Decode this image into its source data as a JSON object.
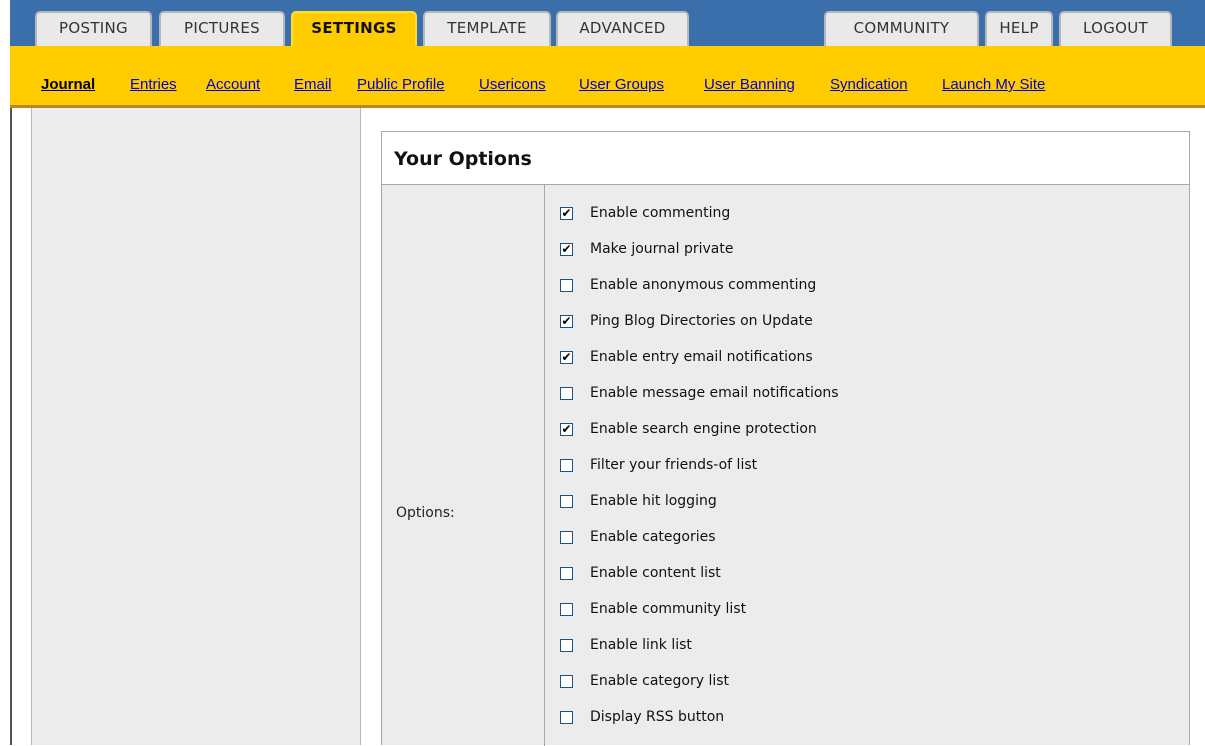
{
  "top_tabs": [
    {
      "label": "POSTING",
      "active": false
    },
    {
      "label": "PICTURES",
      "active": false
    },
    {
      "label": "SETTINGS",
      "active": true
    },
    {
      "label": "TEMPLATE",
      "active": false
    },
    {
      "label": "ADVANCED",
      "active": false
    },
    {
      "label": "COMMUNITY",
      "active": false
    },
    {
      "label": "HELP",
      "active": false
    },
    {
      "label": "LOGOUT",
      "active": false
    }
  ],
  "sub_nav": [
    {
      "label": "Journal",
      "active": true
    },
    {
      "label": "Entries",
      "active": false
    },
    {
      "label": "Account",
      "active": false
    },
    {
      "label": "Email",
      "active": false
    },
    {
      "label": "Public Profile",
      "active": false
    },
    {
      "label": "Usericons",
      "active": false
    },
    {
      "label": "User Groups",
      "active": false
    },
    {
      "label": "User Banning",
      "active": false
    },
    {
      "label": "Syndication",
      "active": false
    },
    {
      "label": "Launch My Site",
      "active": false
    }
  ],
  "options_panel": {
    "title": "Your Options",
    "label": "Options:",
    "items": [
      {
        "label": "Enable commenting",
        "checked": true
      },
      {
        "label": "Make journal private",
        "checked": true
      },
      {
        "label": "Enable anonymous commenting",
        "checked": false
      },
      {
        "label": "Ping Blog Directories on Update",
        "checked": true
      },
      {
        "label": "Enable entry email notifications",
        "checked": true
      },
      {
        "label": "Enable message email notifications",
        "checked": false
      },
      {
        "label": "Enable search engine protection",
        "checked": true
      },
      {
        "label": "Filter your friends-of list",
        "checked": false
      },
      {
        "label": "Enable hit logging",
        "checked": false
      },
      {
        "label": "Enable categories",
        "checked": false
      },
      {
        "label": "Enable content list",
        "checked": false
      },
      {
        "label": "Enable community list",
        "checked": false
      },
      {
        "label": "Enable link list",
        "checked": false
      },
      {
        "label": "Enable category list",
        "checked": false
      },
      {
        "label": "Display RSS button",
        "checked": false
      }
    ]
  },
  "colors": {
    "top_bar": "#3b6fab",
    "accent": "#ffcc00",
    "link": "#0000cc"
  }
}
